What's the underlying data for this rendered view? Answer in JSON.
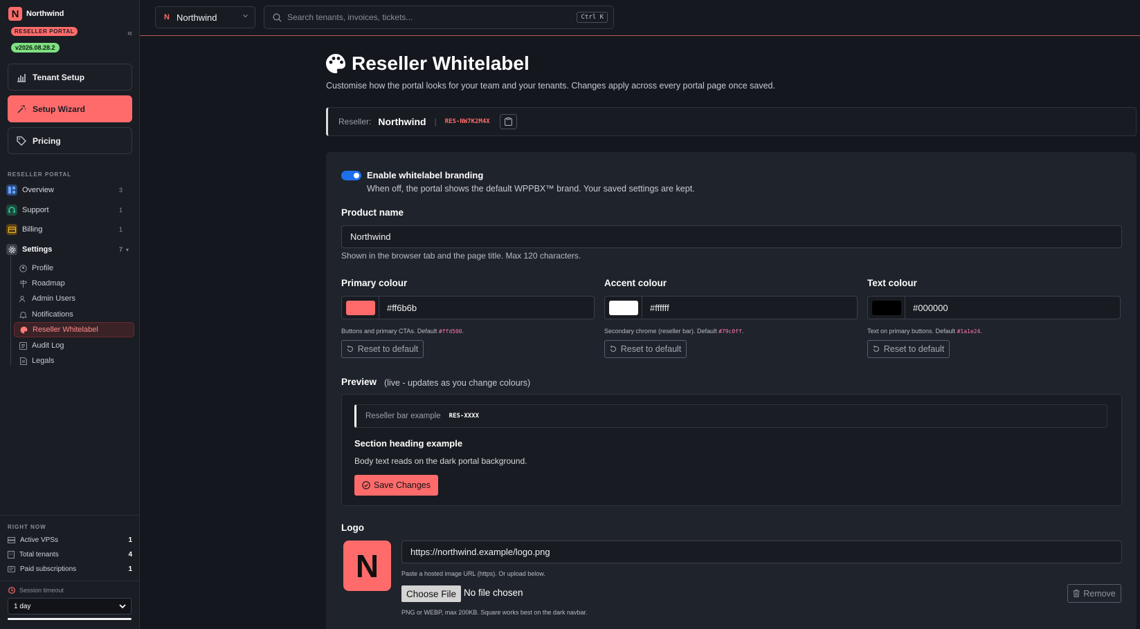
{
  "sidebar": {
    "brand": "Northwind",
    "brand_logo_letter": "N",
    "portal_badge": "RESELLER PORTAL",
    "version": "v2026.08.28.2",
    "big_buttons": [
      {
        "label": "Tenant Setup",
        "icon": "chart-icon"
      },
      {
        "label": "Setup Wizard",
        "icon": "wand-icon"
      },
      {
        "label": "Pricing",
        "icon": "tag-icon"
      }
    ],
    "section_label": "RESELLER PORTAL",
    "nav": [
      {
        "label": "Overview",
        "count": "3",
        "icon": "grid-icon",
        "color": "#3b82f6"
      },
      {
        "label": "Support",
        "count": "1",
        "icon": "headset-icon",
        "color": "#10b981"
      },
      {
        "label": "Billing",
        "count": "1",
        "icon": "card-icon",
        "color": "#f59e0b"
      },
      {
        "label": "Settings",
        "count": "7",
        "icon": "gear-icon",
        "color": "#9ca3af"
      }
    ],
    "settings_sub": [
      {
        "label": "Profile"
      },
      {
        "label": "Roadmap"
      },
      {
        "label": "Admin Users"
      },
      {
        "label": "Notifications"
      },
      {
        "label": "Reseller Whitelabel"
      },
      {
        "label": "Audit Log"
      },
      {
        "label": "Legals"
      }
    ],
    "right_now_label": "RIGHT NOW",
    "right_now": [
      {
        "label": "Active VPSs",
        "value": "1"
      },
      {
        "label": "Total tenants",
        "value": "4"
      },
      {
        "label": "Paid subscriptions",
        "value": "1"
      }
    ],
    "session_label": "Session timeout",
    "session_value": "1 day"
  },
  "topbar": {
    "tenant": "Northwind",
    "tenant_letter": "N",
    "search_placeholder": "Search tenants, invoices, tickets...",
    "shortcut": "Ctrl K"
  },
  "page": {
    "title": "Reseller Whitelabel",
    "subtitle": "Customise how the portal looks for your team and your tenants. Changes apply across every portal page once saved.",
    "reseller_label": "Reseller:",
    "reseller_name": "Northwind",
    "reseller_id": "RES-NW7K2M4X"
  },
  "form": {
    "toggle_label": "Enable whitelabel branding",
    "toggle_desc": "When off, the portal shows the default WPPBX™ brand. Your saved settings are kept.",
    "product_label": "Product name",
    "product_value": "Northwind",
    "product_help": "Shown in the browser tab and the page title. Max 120 characters.",
    "colors": [
      {
        "label": "Primary colour",
        "value": "#ff6b6b",
        "help": "Buttons and primary CTAs. Default",
        "default": "#ffd500"
      },
      {
        "label": "Accent colour",
        "value": "#ffffff",
        "help": "Secondary chrome (reseller bar). Default",
        "default": "#79c0ff"
      },
      {
        "label": "Text colour",
        "value": "#000000",
        "help": "Text on primary buttons. Default",
        "default": "#1a1e24"
      }
    ],
    "reset_label": "Reset to default",
    "preview_title": "Preview",
    "preview_note": "(live - updates as you change colours)",
    "preview_bar_text": "Reseller bar example",
    "preview_bar_id": "RES-XXXX",
    "preview_heading": "Section heading example",
    "preview_body": "Body text reads on the dark portal background.",
    "save_label": "Save Changes",
    "logo_label": "Logo",
    "logo_letter": "N",
    "logo_url": "https://northwind.example/logo.png",
    "logo_help": "Paste a hosted image URL (https). Or upload below.",
    "choose_file": "Choose File",
    "no_file": "No file chosen",
    "remove_label": "Remove",
    "file_help": "PNG or WEBP, max 200KB. Square works best on the dark navbar."
  }
}
